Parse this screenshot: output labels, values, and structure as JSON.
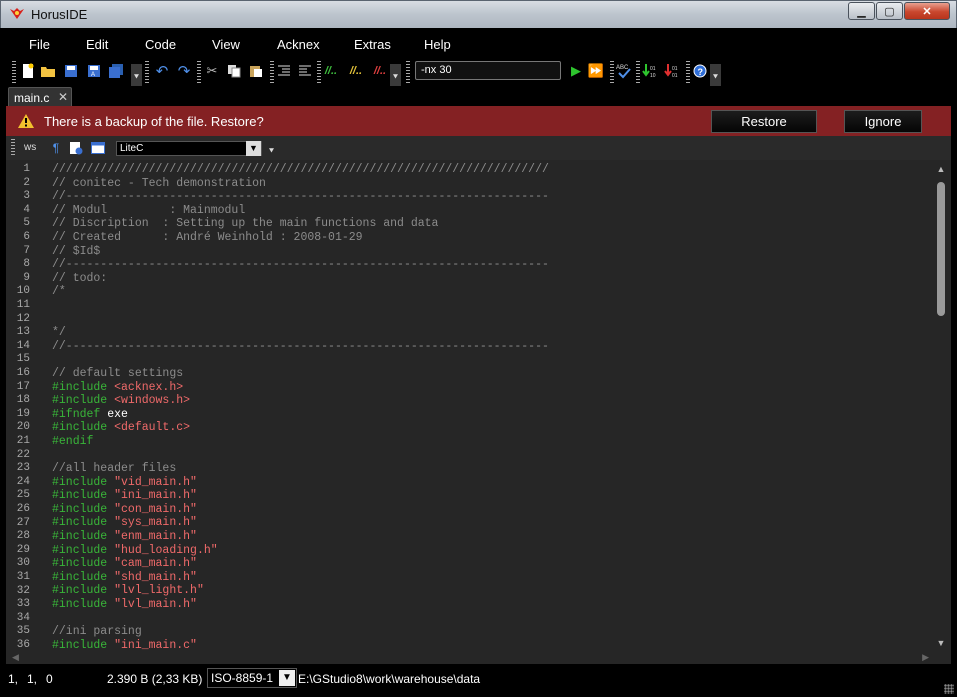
{
  "window": {
    "title": "HorusIDE",
    "minimize": "▁",
    "maximize": "▢",
    "close": "✕"
  },
  "menu": [
    "File",
    "Edit",
    "Code",
    "View",
    "Acknex",
    "Extras",
    "Help"
  ],
  "toolbar": {
    "command_value": "-nx 30"
  },
  "tabs": [
    {
      "label": "main.c",
      "close": "✕"
    }
  ],
  "banner": {
    "message": "There is a backup of the file. Restore?",
    "restore_label": "Restore",
    "ignore_label": "Ignore"
  },
  "editor_toolbar": {
    "ws_label": "ws",
    "language": "LiteC"
  },
  "editor": {
    "lines": [
      [
        [
          "c-comment",
          "////////////////////////////////////////////////////////////////////////"
        ]
      ],
      [
        [
          "c-comment",
          "// conitec - Tech demonstration"
        ]
      ],
      [
        [
          "c-comment",
          "//----------------------------------------------------------------------"
        ]
      ],
      [
        [
          "c-comment",
          "// Modul         : Mainmodul"
        ]
      ],
      [
        [
          "c-comment",
          "// Discription  : Setting up the main functions and data"
        ]
      ],
      [
        [
          "c-comment",
          "// Created      : André Weinhold : 2008-01-29"
        ]
      ],
      [
        [
          "c-comment",
          "// $Id$"
        ]
      ],
      [
        [
          "c-comment",
          "//----------------------------------------------------------------------"
        ]
      ],
      [
        [
          "c-comment",
          "// todo:"
        ]
      ],
      [
        [
          "c-comment",
          "/*"
        ]
      ],
      [
        [
          "c-comment",
          ""
        ]
      ],
      [
        [
          "c-comment",
          ""
        ]
      ],
      [
        [
          "c-comment",
          "*/"
        ]
      ],
      [
        [
          "c-comment",
          "//----------------------------------------------------------------------"
        ]
      ],
      [
        [
          "c-comment",
          ""
        ]
      ],
      [
        [
          "c-comment",
          "// default settings"
        ]
      ],
      [
        [
          "c-pre",
          "#include "
        ],
        [
          "c-str",
          "<acknex.h>"
        ]
      ],
      [
        [
          "c-pre",
          "#include "
        ],
        [
          "c-str",
          "<windows.h>"
        ]
      ],
      [
        [
          "c-pre",
          "#ifndef "
        ],
        [
          "c-plain",
          "exe"
        ]
      ],
      [
        [
          "c-pre",
          "#include "
        ],
        [
          "c-str",
          "<default.c>"
        ]
      ],
      [
        [
          "c-pre",
          "#endif"
        ]
      ],
      [
        [
          "c-comment",
          ""
        ]
      ],
      [
        [
          "c-comment",
          "//all header files"
        ]
      ],
      [
        [
          "c-pre",
          "#include "
        ],
        [
          "c-str",
          "\"vid_main.h\""
        ]
      ],
      [
        [
          "c-pre",
          "#include "
        ],
        [
          "c-str",
          "\"ini_main.h\""
        ]
      ],
      [
        [
          "c-pre",
          "#include "
        ],
        [
          "c-str",
          "\"con_main.h\""
        ]
      ],
      [
        [
          "c-pre",
          "#include "
        ],
        [
          "c-str",
          "\"sys_main.h\""
        ]
      ],
      [
        [
          "c-pre",
          "#include "
        ],
        [
          "c-str",
          "\"enm_main.h\""
        ]
      ],
      [
        [
          "c-pre",
          "#include "
        ],
        [
          "c-str",
          "\"hud_loading.h\""
        ]
      ],
      [
        [
          "c-pre",
          "#include "
        ],
        [
          "c-str",
          "\"cam_main.h\""
        ]
      ],
      [
        [
          "c-pre",
          "#include "
        ],
        [
          "c-str",
          "\"shd_main.h\""
        ]
      ],
      [
        [
          "c-pre",
          "#include "
        ],
        [
          "c-str",
          "\"lvl_light.h\""
        ]
      ],
      [
        [
          "c-pre",
          "#include "
        ],
        [
          "c-str",
          "\"lvl_main.h\""
        ]
      ],
      [
        [
          "c-comment",
          ""
        ]
      ],
      [
        [
          "c-comment",
          "//ini parsing"
        ]
      ],
      [
        [
          "c-pre",
          "#include "
        ],
        [
          "c-str",
          "\"ini_main.c\""
        ]
      ],
      [
        [
          "c-comment",
          ""
        ]
      ]
    ]
  },
  "status": {
    "line": "1,",
    "col": "1,",
    "sel": "0",
    "size": "2.390 B (2,33 KB)",
    "encoding": "ISO-8859-1",
    "path": "E:\\GStudio8\\work\\warehouse\\data"
  }
}
